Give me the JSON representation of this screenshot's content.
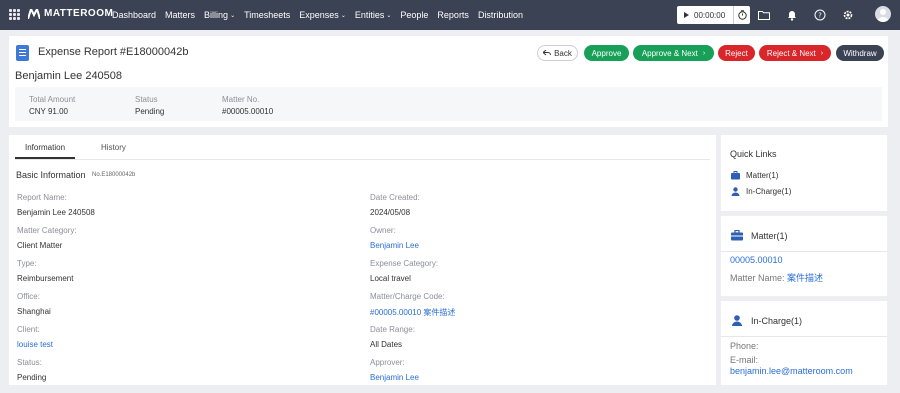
{
  "nav": {
    "brand": "MATTEROOM",
    "items": [
      {
        "label": "Dashboard",
        "caret": ""
      },
      {
        "label": "Matters",
        "caret": ""
      },
      {
        "label": "Billing",
        "caret": "⌄"
      },
      {
        "label": "Timesheets",
        "caret": ""
      },
      {
        "label": "Expenses",
        "caret": "⌄"
      },
      {
        "label": "Entities",
        "caret": "⌄"
      },
      {
        "label": "People",
        "caret": ""
      },
      {
        "label": "Reports",
        "caret": ""
      },
      {
        "label": "Distribution",
        "caret": ""
      }
    ],
    "timer": "00:00:00",
    "icons": [
      "folder-icon",
      "bell-icon",
      "help-icon",
      "gear-icon"
    ]
  },
  "header": {
    "title": "Expense Report #E18000042b",
    "name": "Benjamin Lee 240508",
    "buttons": {
      "back": "Back",
      "approve": "Approve",
      "approve_next": "Approve & Next",
      "reject": "Reject",
      "reject_next": "Reject & Next",
      "withdraw": "Withdraw"
    },
    "summary": {
      "total_label": "Total Amount",
      "total_value": "CNY 91.00",
      "status_label": "Status",
      "status_value": "Pending",
      "matter_label": "Matter No.",
      "matter_value": "#00005.00010"
    }
  },
  "tabs": {
    "information": "Information",
    "history": "History"
  },
  "basic": {
    "title": "Basic Information",
    "number": "No.E18000042b",
    "left": [
      {
        "label": "Report Name:",
        "value": "Benjamin Lee 240508",
        "link": false
      },
      {
        "label": "Matter Category:",
        "value": "Client Matter",
        "link": false
      },
      {
        "label": "Type:",
        "value": "Reimbursement",
        "link": false
      },
      {
        "label": "Office:",
        "value": "Shanghai",
        "link": false
      },
      {
        "label": "Client:",
        "value": "louise test",
        "link": true
      },
      {
        "label": "Status:",
        "value": "Pending",
        "link": false
      }
    ],
    "right": [
      {
        "label": "Date Created:",
        "value": "2024/05/08",
        "link": false
      },
      {
        "label": "Owner:",
        "value": "Benjamin Lee",
        "link": true
      },
      {
        "label": "Expense Category:",
        "value": "Local travel",
        "link": false
      },
      {
        "label": "Matter/Charge Code:",
        "value": "#00005.00010 案件描述",
        "link": true
      },
      {
        "label": "Date Range:",
        "value": "All Dates",
        "link": false
      },
      {
        "label": "Approver:",
        "value": "Benjamin Lee",
        "link": true
      }
    ]
  },
  "quick_links": {
    "title": "Quick Links",
    "items": [
      "Matter(1)",
      "In-Charge(1)"
    ]
  },
  "matter_card": {
    "title": "Matter(1)",
    "number": "00005.00010",
    "name_label": "Matter Name:",
    "name_value": "案件描述"
  },
  "incharge_card": {
    "title": "In-Charge(1)",
    "phone_label": "Phone:",
    "email_label": "E-mail:",
    "email_value": "benjamin.lee@matteroom.com"
  },
  "colors": {
    "nav_bg": "#3b4254",
    "approve": "#18a058",
    "reject": "#d9262a",
    "link": "#2b6ed6"
  }
}
